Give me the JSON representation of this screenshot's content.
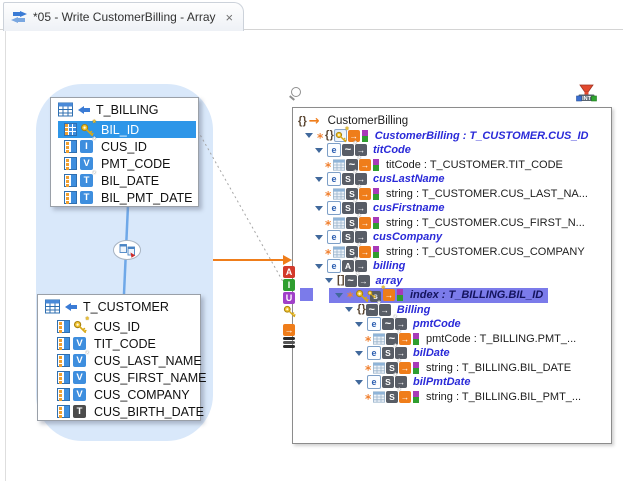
{
  "tab": {
    "title": "*05 - Write CustomerBilling - Array",
    "close_glyph": "×"
  },
  "colors": {
    "accent_orange": "#ef7d1a",
    "table_selection_blue": "#2e96e8",
    "tree_selection_purple": "#7b7bea",
    "join_link_blue": "#6fa8e8",
    "group_background": "#d9e8fa",
    "parent_label_blue": "#2a2ad8"
  },
  "source": {
    "billing": {
      "title": "T_BILLING",
      "columns": [
        {
          "name": "BIL_ID",
          "icon": "grid",
          "type": "key",
          "star": true,
          "selected": true
        },
        {
          "name": "CUS_ID",
          "icon": "col",
          "type": "I",
          "star": true
        },
        {
          "name": "PMT_CODE",
          "icon": "col",
          "type": "V"
        },
        {
          "name": "BIL_DATE",
          "icon": "col",
          "type": "T",
          "star": true
        },
        {
          "name": "BIL_PMT_DATE",
          "icon": "col",
          "type": "T"
        }
      ]
    },
    "customer": {
      "title": "T_CUSTOMER",
      "columns": [
        {
          "name": "CUS_ID",
          "icon": "col",
          "type": "key",
          "star": true
        },
        {
          "name": "TIT_CODE",
          "icon": "col",
          "type": "V"
        },
        {
          "name": "CUS_LAST_NAME",
          "icon": "col",
          "type": "V",
          "star": true
        },
        {
          "name": "CUS_FIRST_NAME",
          "icon": "col",
          "type": "V"
        },
        {
          "name": "CUS_COMPANY",
          "icon": "col",
          "type": "V"
        },
        {
          "name": "CUS_BIRTH_DATE",
          "icon": "col",
          "type": "T",
          "dark": true
        }
      ]
    }
  },
  "palette": {
    "items": [
      {
        "name": "attribute",
        "glyph": "A",
        "color": "#d2392b"
      },
      {
        "name": "integer",
        "glyph": "I",
        "color": "#2f9e2f"
      },
      {
        "name": "union",
        "glyph": "U",
        "color": "#a040c8"
      },
      {
        "name": "key",
        "glyph": "key",
        "color": ""
      },
      {
        "name": "output",
        "glyph": "→",
        "color": "#ef7d1a"
      },
      {
        "name": "layers",
        "glyph": "layers",
        "color": ""
      }
    ]
  },
  "output_tree": {
    "rows": [
      {
        "indent": 5,
        "icons": [
          "braces",
          "map-arrow"
        ],
        "label": "CustomerBilling",
        "kind": "root"
      },
      {
        "indent": 12,
        "icons": [
          "expander",
          "bullet",
          "braces",
          "key-elem",
          "out-orange",
          "badge"
        ],
        "label": "CustomerBilling : T_CUSTOMER.CUS_ID",
        "kind": "parent"
      },
      {
        "indent": 22,
        "icons": [
          "expander",
          "elem",
          "seq-star",
          "out-dark"
        ],
        "label": "titCode",
        "kind": "parent"
      },
      {
        "indent": 32,
        "icons": [
          "bullet",
          "table-cell",
          "seq-star",
          "out-orange",
          "badge"
        ],
        "label": "titCode : T_CUSTOMER.TIT_CODE",
        "kind": "child"
      },
      {
        "indent": 22,
        "icons": [
          "expander",
          "elem",
          "string-star",
          "out-dark"
        ],
        "label": "cusLastName",
        "kind": "parent"
      },
      {
        "indent": 32,
        "icons": [
          "bullet",
          "table-cell",
          "string-star",
          "out-orange",
          "badge"
        ],
        "label": "string : T_CUSTOMER.CUS_LAST_NA...",
        "kind": "child"
      },
      {
        "indent": 22,
        "icons": [
          "expander",
          "elem",
          "string-star",
          "out-dark"
        ],
        "label": "cusFirstname",
        "kind": "parent"
      },
      {
        "indent": 32,
        "icons": [
          "bullet",
          "table-cell",
          "string-star",
          "out-orange",
          "badge"
        ],
        "label": "string : T_CUSTOMER.CUS_FIRST_N...",
        "kind": "child"
      },
      {
        "indent": 22,
        "icons": [
          "expander",
          "elem",
          "string-star",
          "out-dark"
        ],
        "label": "cusCompany",
        "kind": "parent"
      },
      {
        "indent": 32,
        "icons": [
          "bullet",
          "table-cell",
          "string-star",
          "out-orange",
          "badge"
        ],
        "label": "string : T_CUSTOMER.CUS_COMPANY",
        "kind": "child"
      },
      {
        "indent": 22,
        "icons": [
          "expander",
          "elem",
          "array-star",
          "out-dark"
        ],
        "label": "billing",
        "kind": "parent"
      },
      {
        "indent": 32,
        "icons": [
          "expander",
          "brackets",
          "seq-star",
          "out-dark"
        ],
        "label": "array",
        "kind": "parent"
      },
      {
        "indent": 42,
        "icons": [
          "expander",
          "bullet",
          "key-gold",
          "key-s",
          "out-orange",
          "badge"
        ],
        "label": "index : T_BILLING.BIL_ID",
        "kind": "parent",
        "selected": true
      },
      {
        "indent": 52,
        "icons": [
          "expander",
          "braces",
          "seq-star",
          "out-dark"
        ],
        "label": "Billing",
        "kind": "parent"
      },
      {
        "indent": 62,
        "icons": [
          "expander",
          "elem",
          "seq-star",
          "out-dark"
        ],
        "label": "pmtCode",
        "kind": "parent"
      },
      {
        "indent": 72,
        "icons": [
          "bullet",
          "table-cell",
          "seq-star",
          "out-orange",
          "badge"
        ],
        "label": "pmtCode : T_BILLING.PMT_...",
        "kind": "child"
      },
      {
        "indent": 62,
        "icons": [
          "expander",
          "elem",
          "string-star",
          "out-dark"
        ],
        "label": "bilDate",
        "kind": "parent"
      },
      {
        "indent": 72,
        "icons": [
          "bullet",
          "table-cell",
          "string-star",
          "out-orange",
          "badge"
        ],
        "label": "string : T_BILLING.BIL_DATE",
        "kind": "child"
      },
      {
        "indent": 62,
        "icons": [
          "expander",
          "elem",
          "string-star",
          "out-dark"
        ],
        "label": "bilPmtDate",
        "kind": "parent"
      },
      {
        "indent": 72,
        "icons": [
          "bullet",
          "table-cell",
          "string-star",
          "out-orange",
          "badge"
        ],
        "label": "string : T_BILLING.BIL_PMT_...",
        "kind": "child"
      }
    ]
  }
}
